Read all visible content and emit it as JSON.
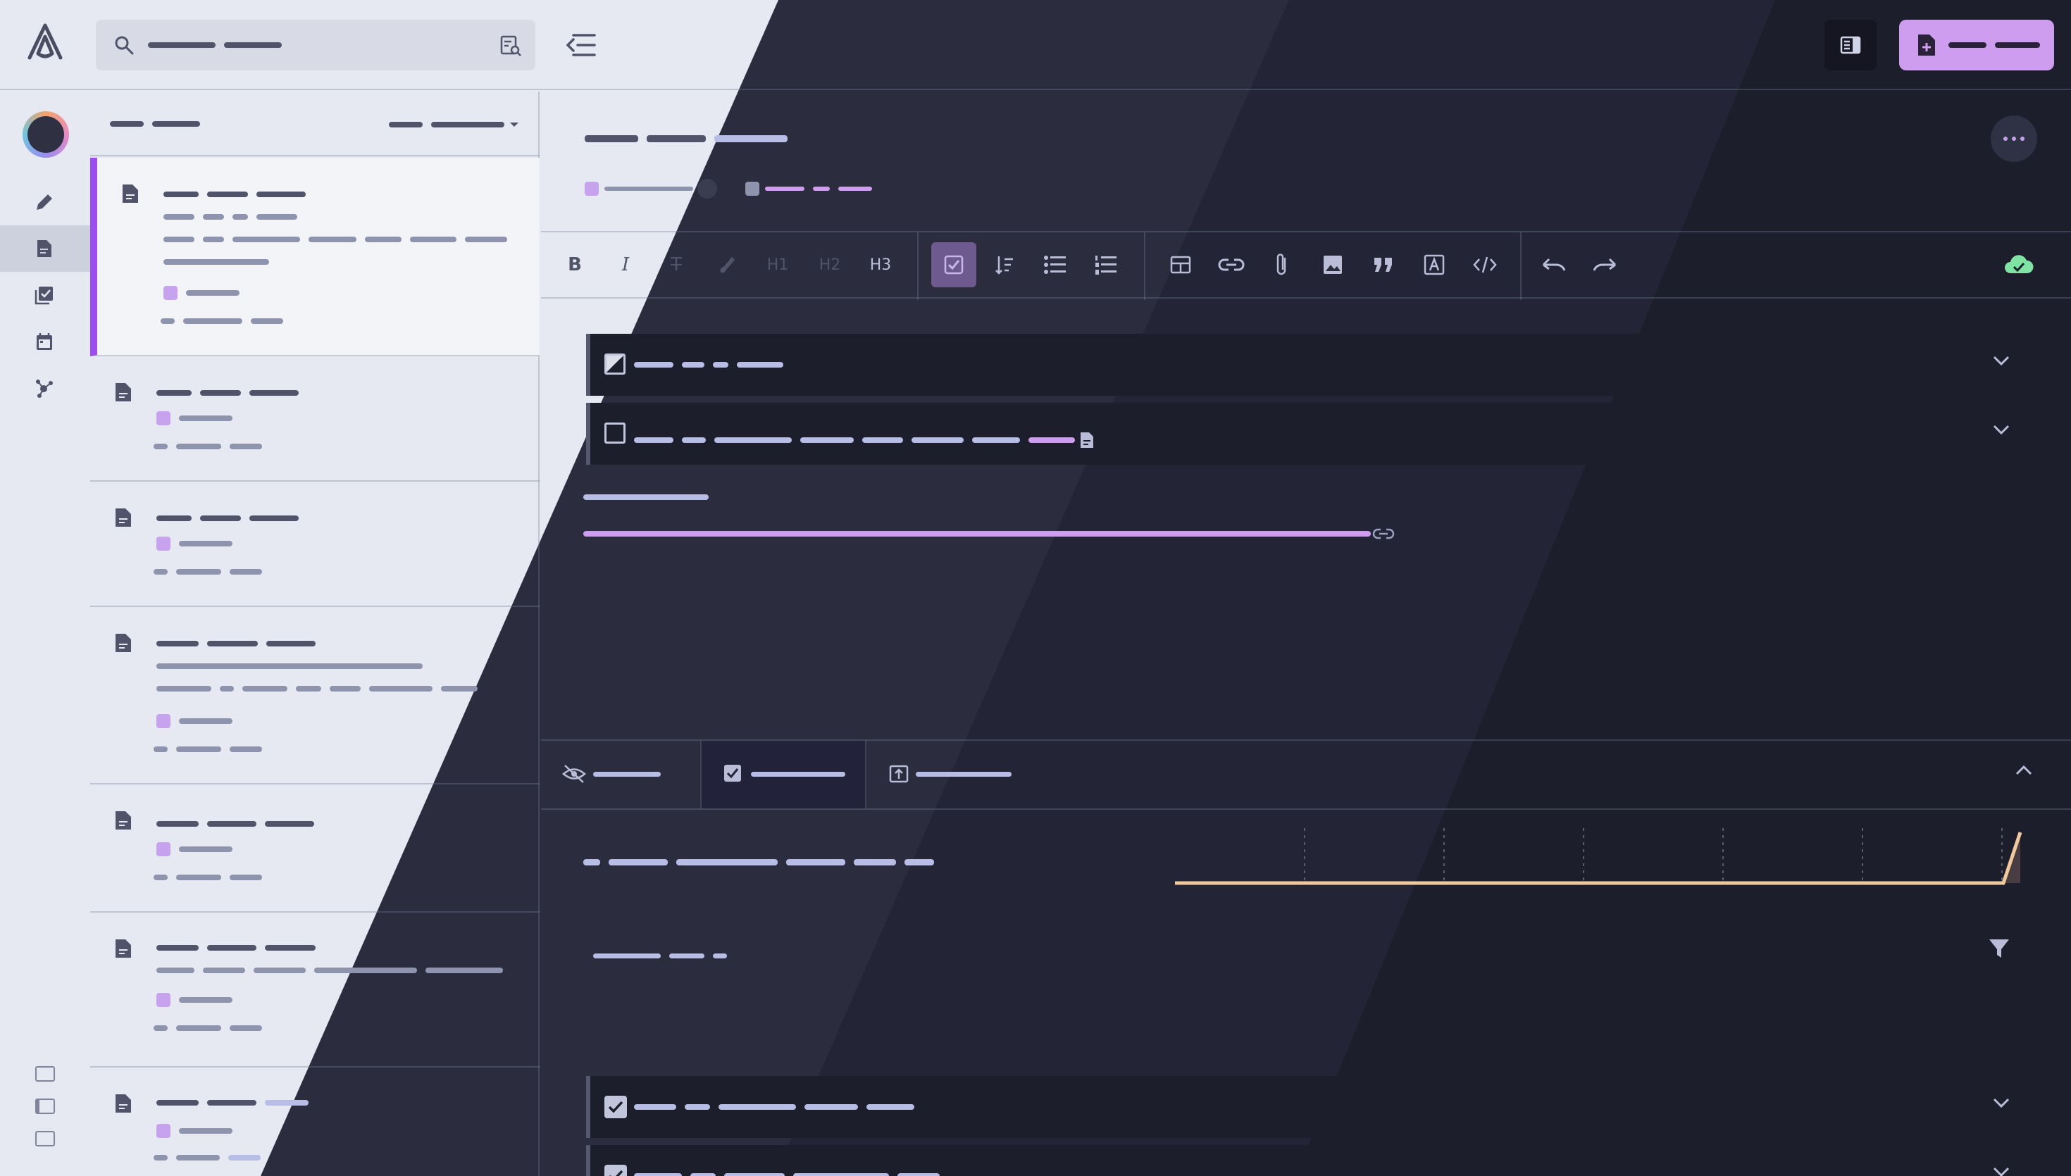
{
  "app": {
    "accent": "#cf9df0",
    "active_note_marker": "#9b4df0"
  },
  "search": {
    "icon": "search-icon",
    "advanced_icon": "advanced-search-icon"
  },
  "topbar": {
    "collapse_icon": "collapse-sidebar-icon",
    "panel_icon": "toggle-panel-icon",
    "new_note_icon": "new-note-icon"
  },
  "toolbar": {
    "h1": "H1",
    "h2": "H2",
    "h3": "H3"
  },
  "icons": {
    "rail": [
      "pencil-icon",
      "notes-icon",
      "tasks-icon",
      "calendar-icon",
      "graph-icon"
    ],
    "toolbar": [
      "bold-icon",
      "italic-icon",
      "strikethrough-icon",
      "highlight-icon",
      "checklist-icon",
      "sort-icon",
      "bullet-list-icon",
      "numbered-list-icon",
      "table-icon",
      "link-icon",
      "attachment-icon",
      "image-icon",
      "quote-icon",
      "text-box-icon",
      "code-icon",
      "undo-icon",
      "redo-icon",
      "cloud-synced-icon"
    ],
    "bottom_tabs": [
      "hidden-icon",
      "checkbox-icon",
      "export-icon"
    ]
  }
}
